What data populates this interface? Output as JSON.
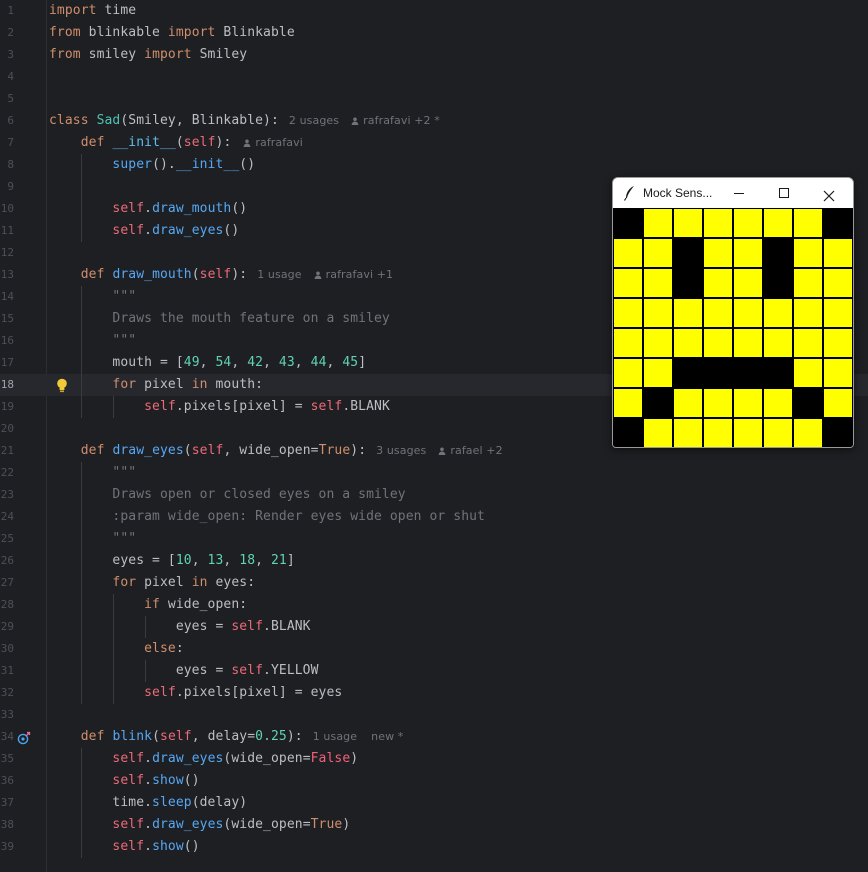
{
  "editor": {
    "current_line": 18,
    "lines": [
      {
        "n": "1",
        "tokens": [
          [
            "kw",
            "import"
          ],
          [
            "t",
            " time"
          ]
        ]
      },
      {
        "n": "2",
        "tokens": [
          [
            "kw",
            "from"
          ],
          [
            "t",
            " blinkable "
          ],
          [
            "kw",
            "import"
          ],
          [
            "t",
            " Blinkable"
          ]
        ]
      },
      {
        "n": "3",
        "tokens": [
          [
            "kw",
            "from"
          ],
          [
            "t",
            " smiley "
          ],
          [
            "kw",
            "import"
          ],
          [
            "t",
            " Smiley"
          ]
        ]
      },
      {
        "n": "4",
        "tokens": []
      },
      {
        "n": "5",
        "tokens": []
      },
      {
        "n": "6",
        "tokens": [
          [
            "kw",
            "class"
          ],
          [
            "t",
            " "
          ],
          [
            "cl",
            "Sad"
          ],
          [
            "t",
            "(Smiley, Blinkable):"
          ]
        ],
        "hint": {
          "usages": "2 usages",
          "author": "rafrafavi +2 *"
        }
      },
      {
        "n": "7",
        "tokens": [
          [
            "t",
            "    "
          ],
          [
            "kw",
            "def"
          ],
          [
            "t",
            " "
          ],
          [
            "mt",
            "__init__"
          ],
          [
            "t",
            "("
          ],
          [
            "sf",
            "self"
          ],
          [
            "t",
            "):"
          ]
        ],
        "hint": {
          "author": "rafrafavi"
        }
      },
      {
        "n": "8",
        "tokens": [
          [
            "t",
            "        "
          ],
          [
            "fn",
            "super"
          ],
          [
            "t",
            "()."
          ],
          [
            "fn",
            "__init__"
          ],
          [
            "t",
            "()"
          ]
        ]
      },
      {
        "n": "9",
        "tokens": []
      },
      {
        "n": "10",
        "tokens": [
          [
            "t",
            "        "
          ],
          [
            "sf",
            "self"
          ],
          [
            "t",
            "."
          ],
          [
            "fn",
            "draw_mouth"
          ],
          [
            "t",
            "()"
          ]
        ]
      },
      {
        "n": "11",
        "tokens": [
          [
            "t",
            "        "
          ],
          [
            "sf",
            "self"
          ],
          [
            "t",
            "."
          ],
          [
            "fn",
            "draw_eyes"
          ],
          [
            "t",
            "()"
          ]
        ]
      },
      {
        "n": "12",
        "tokens": []
      },
      {
        "n": "13",
        "tokens": [
          [
            "t",
            "    "
          ],
          [
            "kw",
            "def"
          ],
          [
            "t",
            " "
          ],
          [
            "fn",
            "draw_mouth"
          ],
          [
            "t",
            "("
          ],
          [
            "sf",
            "self"
          ],
          [
            "t",
            "):"
          ]
        ],
        "hint": {
          "usages": "1 usage",
          "author": "rafrafavi +1"
        }
      },
      {
        "n": "14",
        "tokens": [
          [
            "t",
            "        "
          ],
          [
            "doc",
            "\"\"\""
          ]
        ]
      },
      {
        "n": "15",
        "tokens": [
          [
            "t",
            "        "
          ],
          [
            "doc",
            "Draws the mouth feature on a smiley"
          ]
        ]
      },
      {
        "n": "16",
        "tokens": [
          [
            "t",
            "        "
          ],
          [
            "doc",
            "\"\"\""
          ]
        ]
      },
      {
        "n": "17",
        "tokens": [
          [
            "t",
            "        mouth = ["
          ],
          [
            "num",
            "49"
          ],
          [
            "t",
            ", "
          ],
          [
            "num",
            "54"
          ],
          [
            "t",
            ", "
          ],
          [
            "num",
            "42"
          ],
          [
            "t",
            ", "
          ],
          [
            "num",
            "43"
          ],
          [
            "t",
            ", "
          ],
          [
            "num",
            "44"
          ],
          [
            "t",
            ", "
          ],
          [
            "num",
            "45"
          ],
          [
            "t",
            "]"
          ]
        ]
      },
      {
        "n": "18",
        "tokens": [
          [
            "t",
            "        "
          ],
          [
            "kw",
            "for"
          ],
          [
            "t",
            " pixel "
          ],
          [
            "kw",
            "in"
          ],
          [
            "t",
            " mouth:"
          ]
        ],
        "bulb": true
      },
      {
        "n": "19",
        "tokens": [
          [
            "t",
            "            "
          ],
          [
            "sf",
            "self"
          ],
          [
            "t",
            ".pixels[pixel] = "
          ],
          [
            "sf",
            "self"
          ],
          [
            "t",
            ".BLANK"
          ]
        ]
      },
      {
        "n": "20",
        "tokens": []
      },
      {
        "n": "21",
        "tokens": [
          [
            "t",
            "    "
          ],
          [
            "kw",
            "def"
          ],
          [
            "t",
            " "
          ],
          [
            "fn",
            "draw_eyes"
          ],
          [
            "t",
            "("
          ],
          [
            "sf",
            "self"
          ],
          [
            "t",
            ", wide_open="
          ],
          [
            "kw",
            "True"
          ],
          [
            "t",
            "):"
          ]
        ],
        "hint": {
          "usages": "3 usages",
          "author": "rafael +2"
        }
      },
      {
        "n": "22",
        "tokens": [
          [
            "t",
            "        "
          ],
          [
            "doc",
            "\"\"\""
          ]
        ]
      },
      {
        "n": "23",
        "tokens": [
          [
            "t",
            "        "
          ],
          [
            "doc",
            "Draws open or closed eyes on a smiley"
          ]
        ]
      },
      {
        "n": "24",
        "tokens": [
          [
            "t",
            "        "
          ],
          [
            "doc",
            ":param wide_open: Render eyes wide open or shut"
          ]
        ]
      },
      {
        "n": "25",
        "tokens": [
          [
            "t",
            "        "
          ],
          [
            "doc",
            "\"\"\""
          ]
        ]
      },
      {
        "n": "26",
        "tokens": [
          [
            "t",
            "        eyes = ["
          ],
          [
            "num",
            "10"
          ],
          [
            "t",
            ", "
          ],
          [
            "num",
            "13"
          ],
          [
            "t",
            ", "
          ],
          [
            "num",
            "18"
          ],
          [
            "t",
            ", "
          ],
          [
            "num",
            "21"
          ],
          [
            "t",
            "]"
          ]
        ]
      },
      {
        "n": "27",
        "tokens": [
          [
            "t",
            "        "
          ],
          [
            "kw",
            "for"
          ],
          [
            "t",
            " pixel "
          ],
          [
            "kw",
            "in"
          ],
          [
            "t",
            " eyes:"
          ]
        ]
      },
      {
        "n": "28",
        "tokens": [
          [
            "t",
            "            "
          ],
          [
            "kw",
            "if"
          ],
          [
            "t",
            " wide_open:"
          ]
        ]
      },
      {
        "n": "29",
        "tokens": [
          [
            "t",
            "                eyes = "
          ],
          [
            "sf",
            "self"
          ],
          [
            "t",
            ".BLANK"
          ]
        ]
      },
      {
        "n": "30",
        "tokens": [
          [
            "t",
            "            "
          ],
          [
            "kw",
            "else"
          ],
          [
            "t",
            ":"
          ]
        ]
      },
      {
        "n": "31",
        "tokens": [
          [
            "t",
            "                eyes = "
          ],
          [
            "sf",
            "self"
          ],
          [
            "t",
            ".YELLOW"
          ]
        ]
      },
      {
        "n": "32",
        "tokens": [
          [
            "t",
            "            "
          ],
          [
            "sf",
            "self"
          ],
          [
            "t",
            ".pixels[pixel] = eyes"
          ]
        ]
      },
      {
        "n": "33",
        "tokens": []
      },
      {
        "n": "34",
        "tokens": [
          [
            "t",
            "    "
          ],
          [
            "kw",
            "def"
          ],
          [
            "t",
            " "
          ],
          [
            "fn",
            "blink"
          ],
          [
            "t",
            "("
          ],
          [
            "sf",
            "self"
          ],
          [
            "t",
            ", delay="
          ],
          [
            "num",
            "0.25"
          ],
          [
            "t",
            "):"
          ]
        ],
        "hint": {
          "usages": "1 usage",
          "author": "new *",
          "no_person": true
        },
        "gicon": true
      },
      {
        "n": "35",
        "tokens": [
          [
            "t",
            "        "
          ],
          [
            "sf",
            "self"
          ],
          [
            "t",
            "."
          ],
          [
            "fn",
            "draw_eyes"
          ],
          [
            "t",
            "(wide_open="
          ],
          [
            "k2",
            "False"
          ],
          [
            "t",
            ")"
          ]
        ]
      },
      {
        "n": "36",
        "tokens": [
          [
            "t",
            "        "
          ],
          [
            "sf",
            "self"
          ],
          [
            "t",
            "."
          ],
          [
            "fn",
            "show"
          ],
          [
            "t",
            "()"
          ]
        ]
      },
      {
        "n": "37",
        "tokens": [
          [
            "t",
            "        time."
          ],
          [
            "fn",
            "sleep"
          ],
          [
            "t",
            "(delay)"
          ]
        ]
      },
      {
        "n": "38",
        "tokens": [
          [
            "t",
            "        "
          ],
          [
            "sf",
            "self"
          ],
          [
            "t",
            "."
          ],
          [
            "fn",
            "draw_eyes"
          ],
          [
            "t",
            "(wide_open="
          ],
          [
            "kw",
            "True"
          ],
          [
            "t",
            ")"
          ]
        ]
      },
      {
        "n": "39",
        "tokens": [
          [
            "t",
            "        "
          ],
          [
            "sf",
            "self"
          ],
          [
            "t",
            "."
          ],
          [
            "fn",
            "show"
          ],
          [
            "t",
            "()"
          ]
        ]
      }
    ]
  },
  "sensor_window": {
    "title": "Mock Sens...",
    "icon": "feather-icon",
    "controls": [
      "minimize-icon",
      "maximize-icon",
      "close-icon"
    ],
    "pixels": [
      "KYYYYYYK",
      "YYKYYKYY",
      "YYKYYKYY",
      "YYYYYYYY",
      "YYYYYYYY",
      "YYKKKKYY",
      "YKYYYYKY",
      "KYYYYYYK"
    ],
    "colors": {
      "Y": "#ffff00",
      "K": "#000000"
    }
  },
  "theme": {
    "background": "#1e1f22",
    "keyword": "#cf8e6d",
    "function": "#56a8f5",
    "self": "#ec6a79",
    "number": "#5fd3b4",
    "docstring": "#6f737a"
  }
}
